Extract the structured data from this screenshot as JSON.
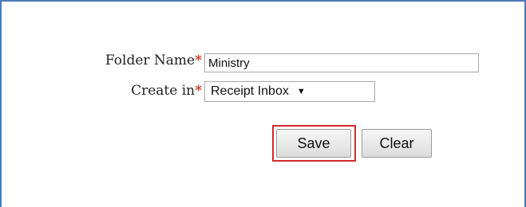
{
  "form": {
    "folder_name_label": "Folder Name",
    "create_in_label": "Create in",
    "required_marker": "*",
    "folder_name_value": "Ministry",
    "create_in_selected": "Receipt Inbox",
    "dropdown_arrow": "▼",
    "save_label": "Save",
    "clear_label": "Clear"
  },
  "colors": {
    "frame_border": "#4a7ab8",
    "required": "#c0392b",
    "highlight": "#d42a2a"
  }
}
